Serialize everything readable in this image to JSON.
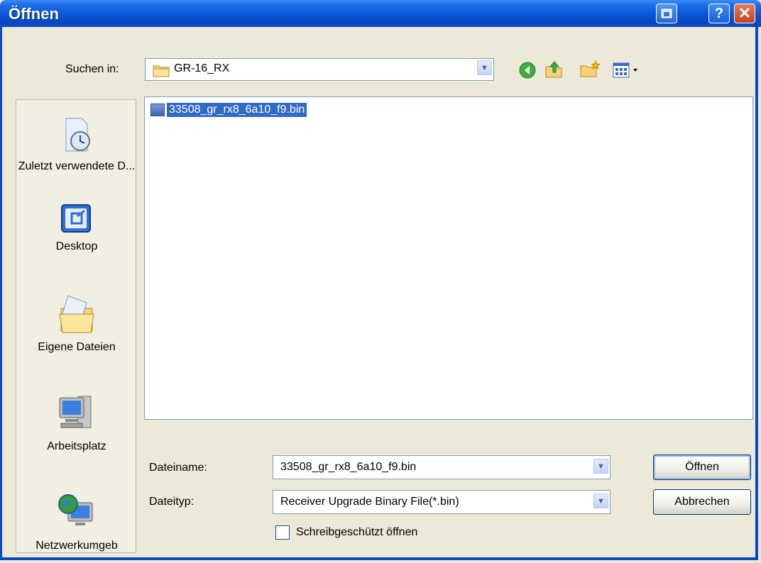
{
  "window": {
    "title": "Öffnen",
    "help_glyph": "?",
    "close_glyph": "✕"
  },
  "lookin": {
    "label": "Suchen in:",
    "value": "GR-16_RX"
  },
  "toolbar": {
    "back_icon": "back-arrow-icon",
    "up_icon": "up-folder-icon",
    "new_folder_icon": "new-folder-icon",
    "view_icon": "view-menu-icon"
  },
  "places": [
    {
      "label": "Zuletzt verwendete D...",
      "icon": "recent-documents-icon"
    },
    {
      "label": "Desktop",
      "icon": "desktop-icon"
    },
    {
      "label": "Eigene Dateien",
      "icon": "my-documents-icon"
    },
    {
      "label": "Arbeitsplatz",
      "icon": "my-computer-icon"
    },
    {
      "label": "Netzwerkumgeb",
      "icon": "network-icon"
    }
  ],
  "files": [
    {
      "name": "33508_gr_rx8_6a10_f9.bin",
      "selected": true
    }
  ],
  "filename": {
    "label": "Dateiname:",
    "value": "33508_gr_rx8_6a10_f9.bin"
  },
  "filetype": {
    "label": "Dateityp:",
    "value": "Receiver Upgrade Binary File(*.bin)"
  },
  "readonly": {
    "label": "Schreibgeschützt öffnen",
    "checked": false
  },
  "buttons": {
    "open": "Öffnen",
    "cancel": "Abbrechen"
  },
  "colors": {
    "titlebar": "#0a56d8",
    "selection": "#316ac5",
    "dialog_bg": "#ece9d8"
  }
}
